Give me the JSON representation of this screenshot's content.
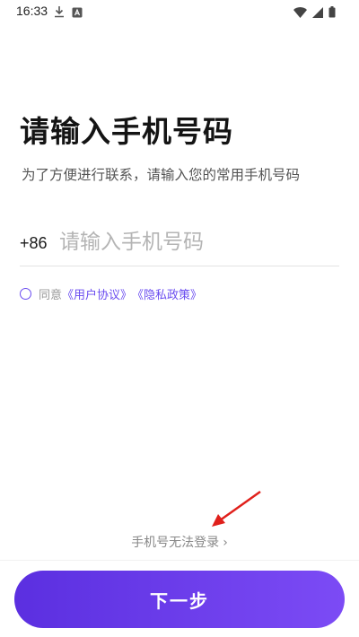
{
  "status_bar": {
    "time": "16:33",
    "icons": [
      "download-icon",
      "app-notification-icon",
      "wifi-icon",
      "signal-icon",
      "battery-icon"
    ]
  },
  "login": {
    "title": "请输入手机号码",
    "subtitle": "为了方便进行联系，请输入您的常用手机号码",
    "country_code": "+86",
    "phone_placeholder": "请输入手机号码",
    "phone_value": "",
    "agree_prefix": "同意",
    "user_agreement": "《用户协议》",
    "privacy_policy": "《隐私政策》",
    "cannot_login": "手机号无法登录",
    "next_button": "下一步"
  },
  "colors": {
    "accent": "#6a4cf0",
    "button_gradient_start": "#5b2fe0",
    "button_gradient_end": "#7c4bf5",
    "annotation_arrow": "#e0201b"
  }
}
